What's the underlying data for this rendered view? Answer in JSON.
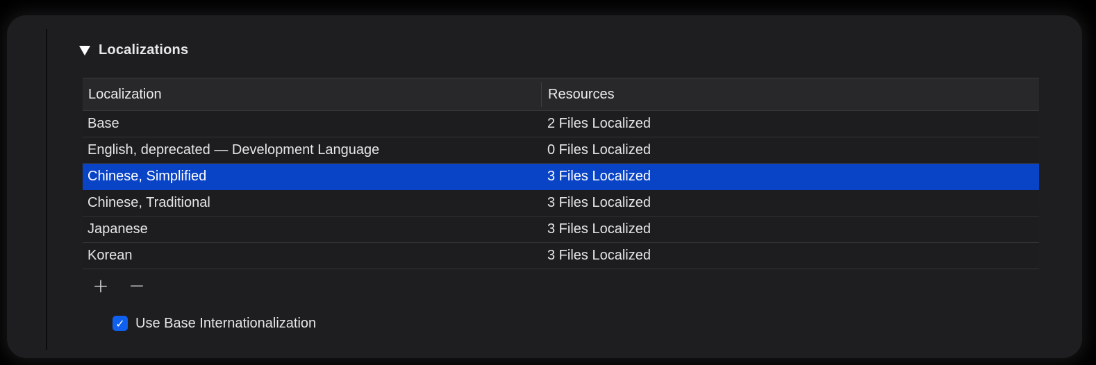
{
  "section": {
    "title": "Localizations",
    "disclosure_icon": "triangle-down-icon"
  },
  "table": {
    "columns": [
      "Localization",
      "Resources"
    ],
    "rows": [
      {
        "localization": "Base",
        "resources": "2 Files Localized"
      },
      {
        "localization": "English, deprecated — Development Language",
        "resources": "0 Files Localized"
      },
      {
        "localization": "Chinese, Simplified",
        "resources": "3 Files Localized"
      },
      {
        "localization": "Chinese, Traditional",
        "resources": "3 Files Localized"
      },
      {
        "localization": "Japanese",
        "resources": "3 Files Localized"
      },
      {
        "localization": "Korean",
        "resources": "3 Files Localized"
      }
    ],
    "selected_row": 2
  },
  "controls": {
    "add_symbol": "+",
    "remove_symbol": "−"
  },
  "checkbox": {
    "label": "Use Base Internationalization",
    "checked": true,
    "check_symbol": "✓"
  },
  "colors": {
    "selection": "#0a44c6",
    "checkbox": "#1060f0",
    "background": "#1e1e20"
  }
}
